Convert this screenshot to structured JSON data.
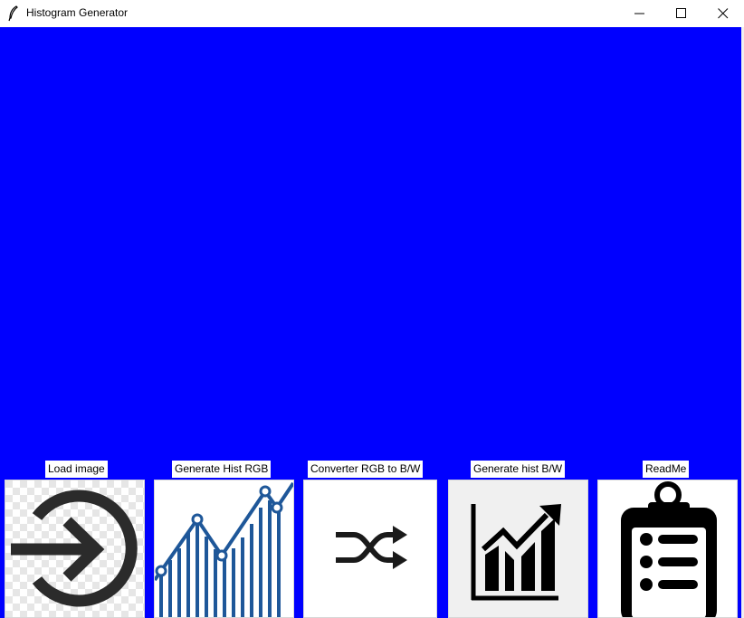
{
  "window": {
    "title": "Histogram Generator",
    "controls": [
      "minimize",
      "maximize",
      "close"
    ]
  },
  "canvas": {
    "color": "#0000ff"
  },
  "buttons": [
    {
      "label": "Load image",
      "icon": "login-arrow-icon"
    },
    {
      "label": "Generate Hist RGB",
      "icon": "line-bar-chart-icon"
    },
    {
      "label": "Converter RGB to B/W",
      "icon": "shuffle-icon"
    },
    {
      "label": "Generate hist B/W",
      "icon": "growth-chart-icon"
    },
    {
      "label": "ReadMe",
      "icon": "clipboard-list-icon"
    }
  ]
}
